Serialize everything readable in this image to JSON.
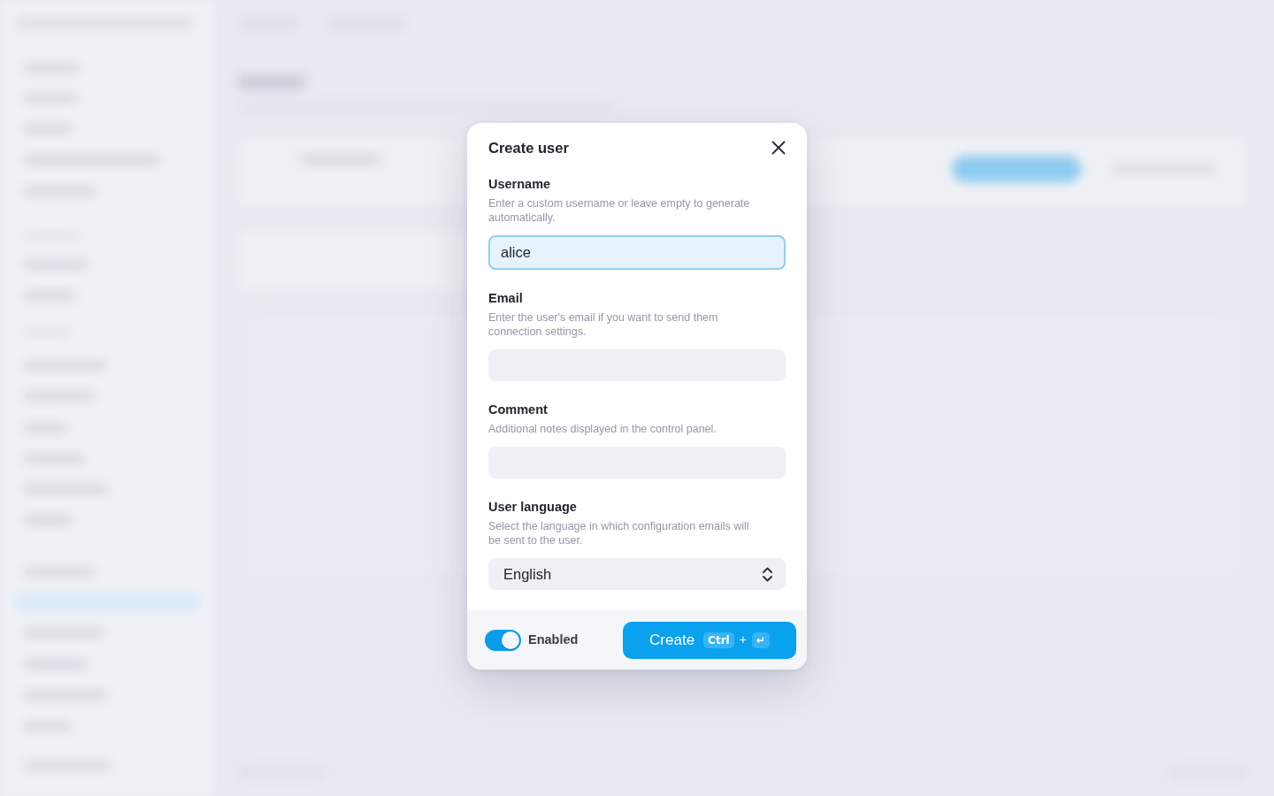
{
  "dialog": {
    "title": "Create user",
    "fields": [
      {
        "kind": "text",
        "label": "Username",
        "hint": "Enter a custom username or leave empty to generate automatically.",
        "value": "alice",
        "focused": true
      },
      {
        "kind": "text",
        "label": "Email",
        "hint": "Enter the user's email if you want to send them connection settings.",
        "focused": false
      },
      {
        "kind": "text",
        "label": "Comment",
        "hint": "Additional notes displayed in the control panel.",
        "focused": false
      },
      {
        "kind": "select",
        "label": "User language",
        "hint": "Select the language in which configuration emails will be sent to the user.",
        "value": "English",
        "focused": false
      }
    ],
    "footer": {
      "toggle": {
        "label": "Enabled",
        "on": true
      },
      "submit": {
        "label": "Create",
        "shortcut": [
          {
            "kind": "key",
            "text": "Ctrl"
          },
          {
            "kind": "separator",
            "text": "+"
          },
          {
            "kind": "key",
            "text": "↵"
          }
        ]
      }
    }
  }
}
